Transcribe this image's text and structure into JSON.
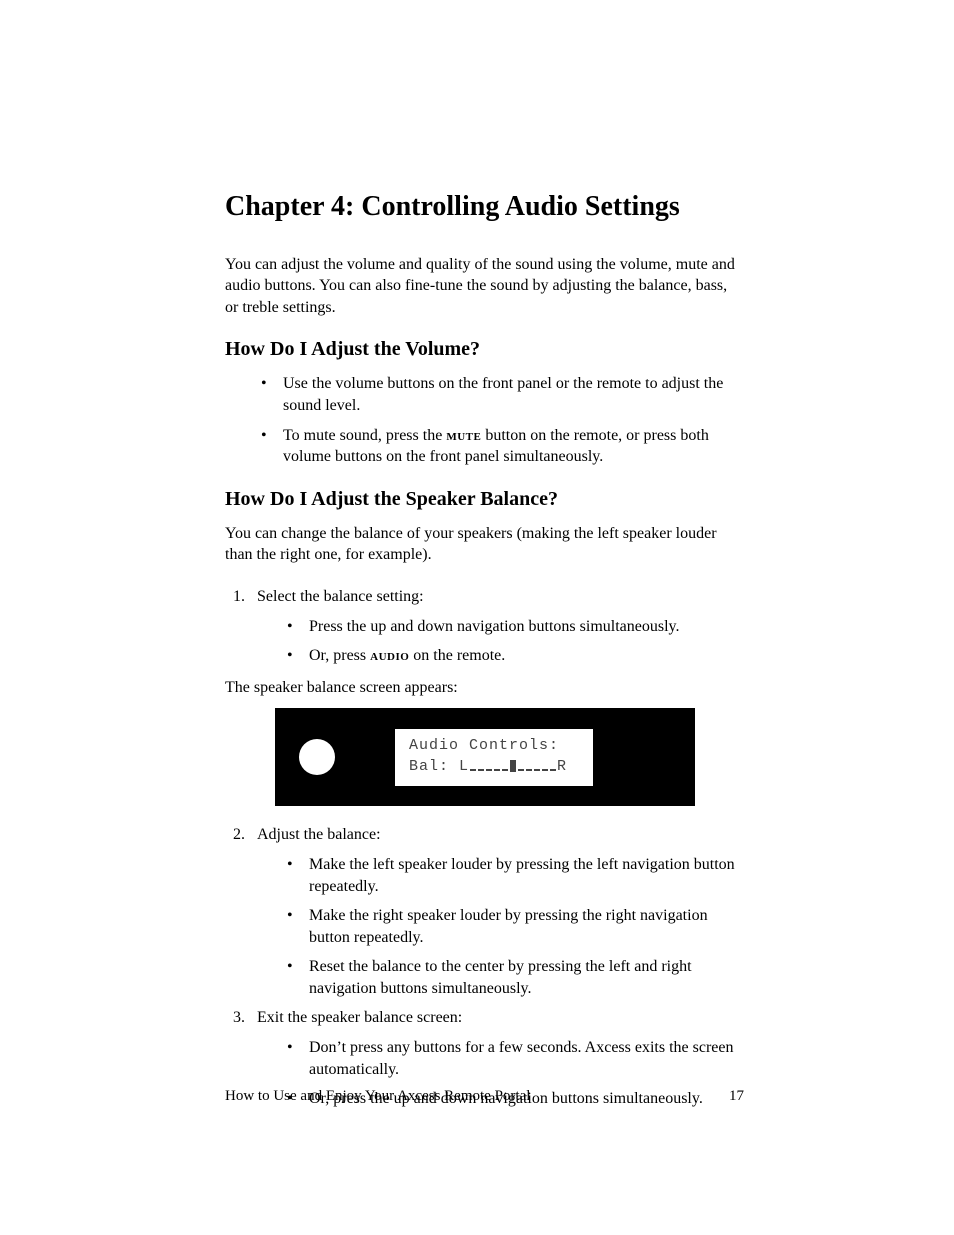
{
  "chapter_title": "Chapter 4: Controlling Audio Settings",
  "intro_paragraph": "You can adjust the volume and quality of the sound using the volume, mute and audio buttons. You can also fine-tune the sound by adjusting the balance, bass, or treble settings.",
  "section_volume": {
    "heading": "How Do I Adjust the Volume?",
    "bullets": [
      "Use the volume buttons on the front panel or the remote to adjust the sound level.",
      {
        "pre": "To mute sound, press the ",
        "key": "mute",
        "post": " button on the remote, or press both volume buttons on the front panel simultaneously."
      }
    ]
  },
  "section_balance": {
    "heading": "How Do I Adjust the Speaker Balance?",
    "intro": "You can change the balance of your speakers (making the left speaker louder than the right one, for example).",
    "step1": {
      "text": "Select the balance setting:",
      "sub": [
        "Press the up and down navigation buttons simultaneously.",
        {
          "pre": "Or, press ",
          "key": "audio",
          "post": " on the remote."
        }
      ]
    },
    "screen_caption": "The speaker balance screen appears:",
    "lcd": {
      "line1": "Audio Controls:",
      "line2_prefix": "Bal: L",
      "line2_suffix": "R"
    },
    "step2": {
      "text": "Adjust the balance:",
      "sub": [
        "Make the left speaker louder by pressing the left navigation button repeatedly.",
        "Make the right speaker louder by pressing the right navigation button repeatedly.",
        "Reset the balance to the center by pressing the left and right navigation buttons simultaneously."
      ]
    },
    "step3": {
      "text": "Exit the speaker balance screen:",
      "sub": [
        "Don’t press any buttons for a few seconds. Axcess exits the screen automatically.",
        "Or, press the up and down navigation buttons simultaneously."
      ]
    }
  },
  "footer": {
    "title": "How to Use and Enjoy Your Axcess Remote Portal",
    "page": "17"
  }
}
